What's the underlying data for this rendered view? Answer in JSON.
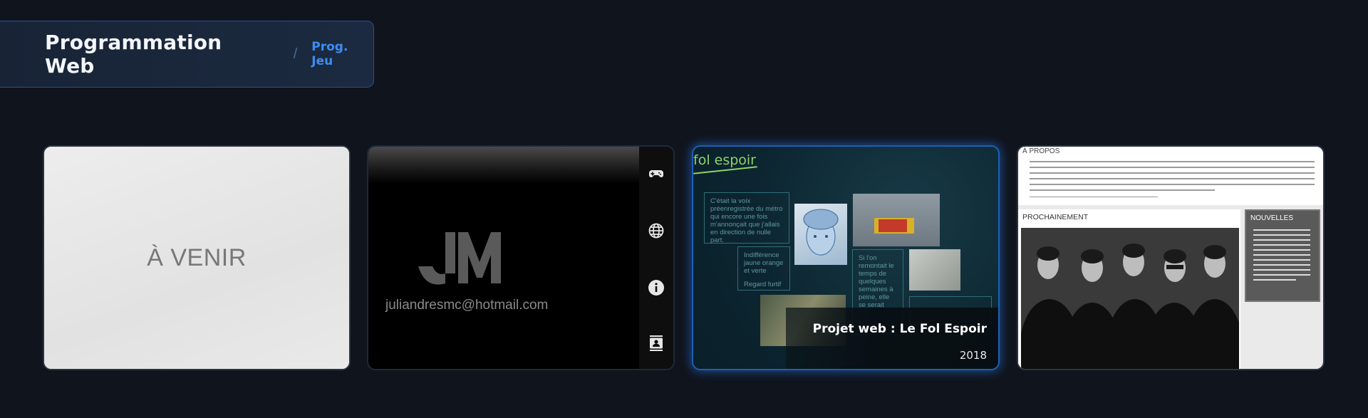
{
  "header": {
    "title": "Programmation Web",
    "separator": "/",
    "subtitle": "Prog. Jeu"
  },
  "cards": [
    {
      "placeholder": "À VENIR"
    },
    {
      "email": "juliandresmc@hotmail.com",
      "logo_text": "JM",
      "side_icons": [
        "gamepad-icon",
        "globe-icon",
        "info-icon",
        "contact-card-icon"
      ]
    },
    {
      "brand": "fol espoir",
      "box_texts": [
        "C'était la voix préenregistrée du métro qui encore une fois m'annonçait que j'allais en direction de nulle part.",
        "Indifférence jaune orange et verte",
        "Regard furtif",
        "Si l'on remontait le temps de quelques semaines à peine, elle se serait"
      ],
      "caption_title": "Projet web : Le Fol Espoir",
      "caption_year": "2018"
    },
    {
      "about": "À PROPOS",
      "upcoming": "PROCHAINEMENT",
      "news": "NOUVELLES"
    }
  ],
  "colors": {
    "background": "#10141d",
    "accent": "#3d8cf2",
    "highlight_border": "#1c5fb8"
  }
}
